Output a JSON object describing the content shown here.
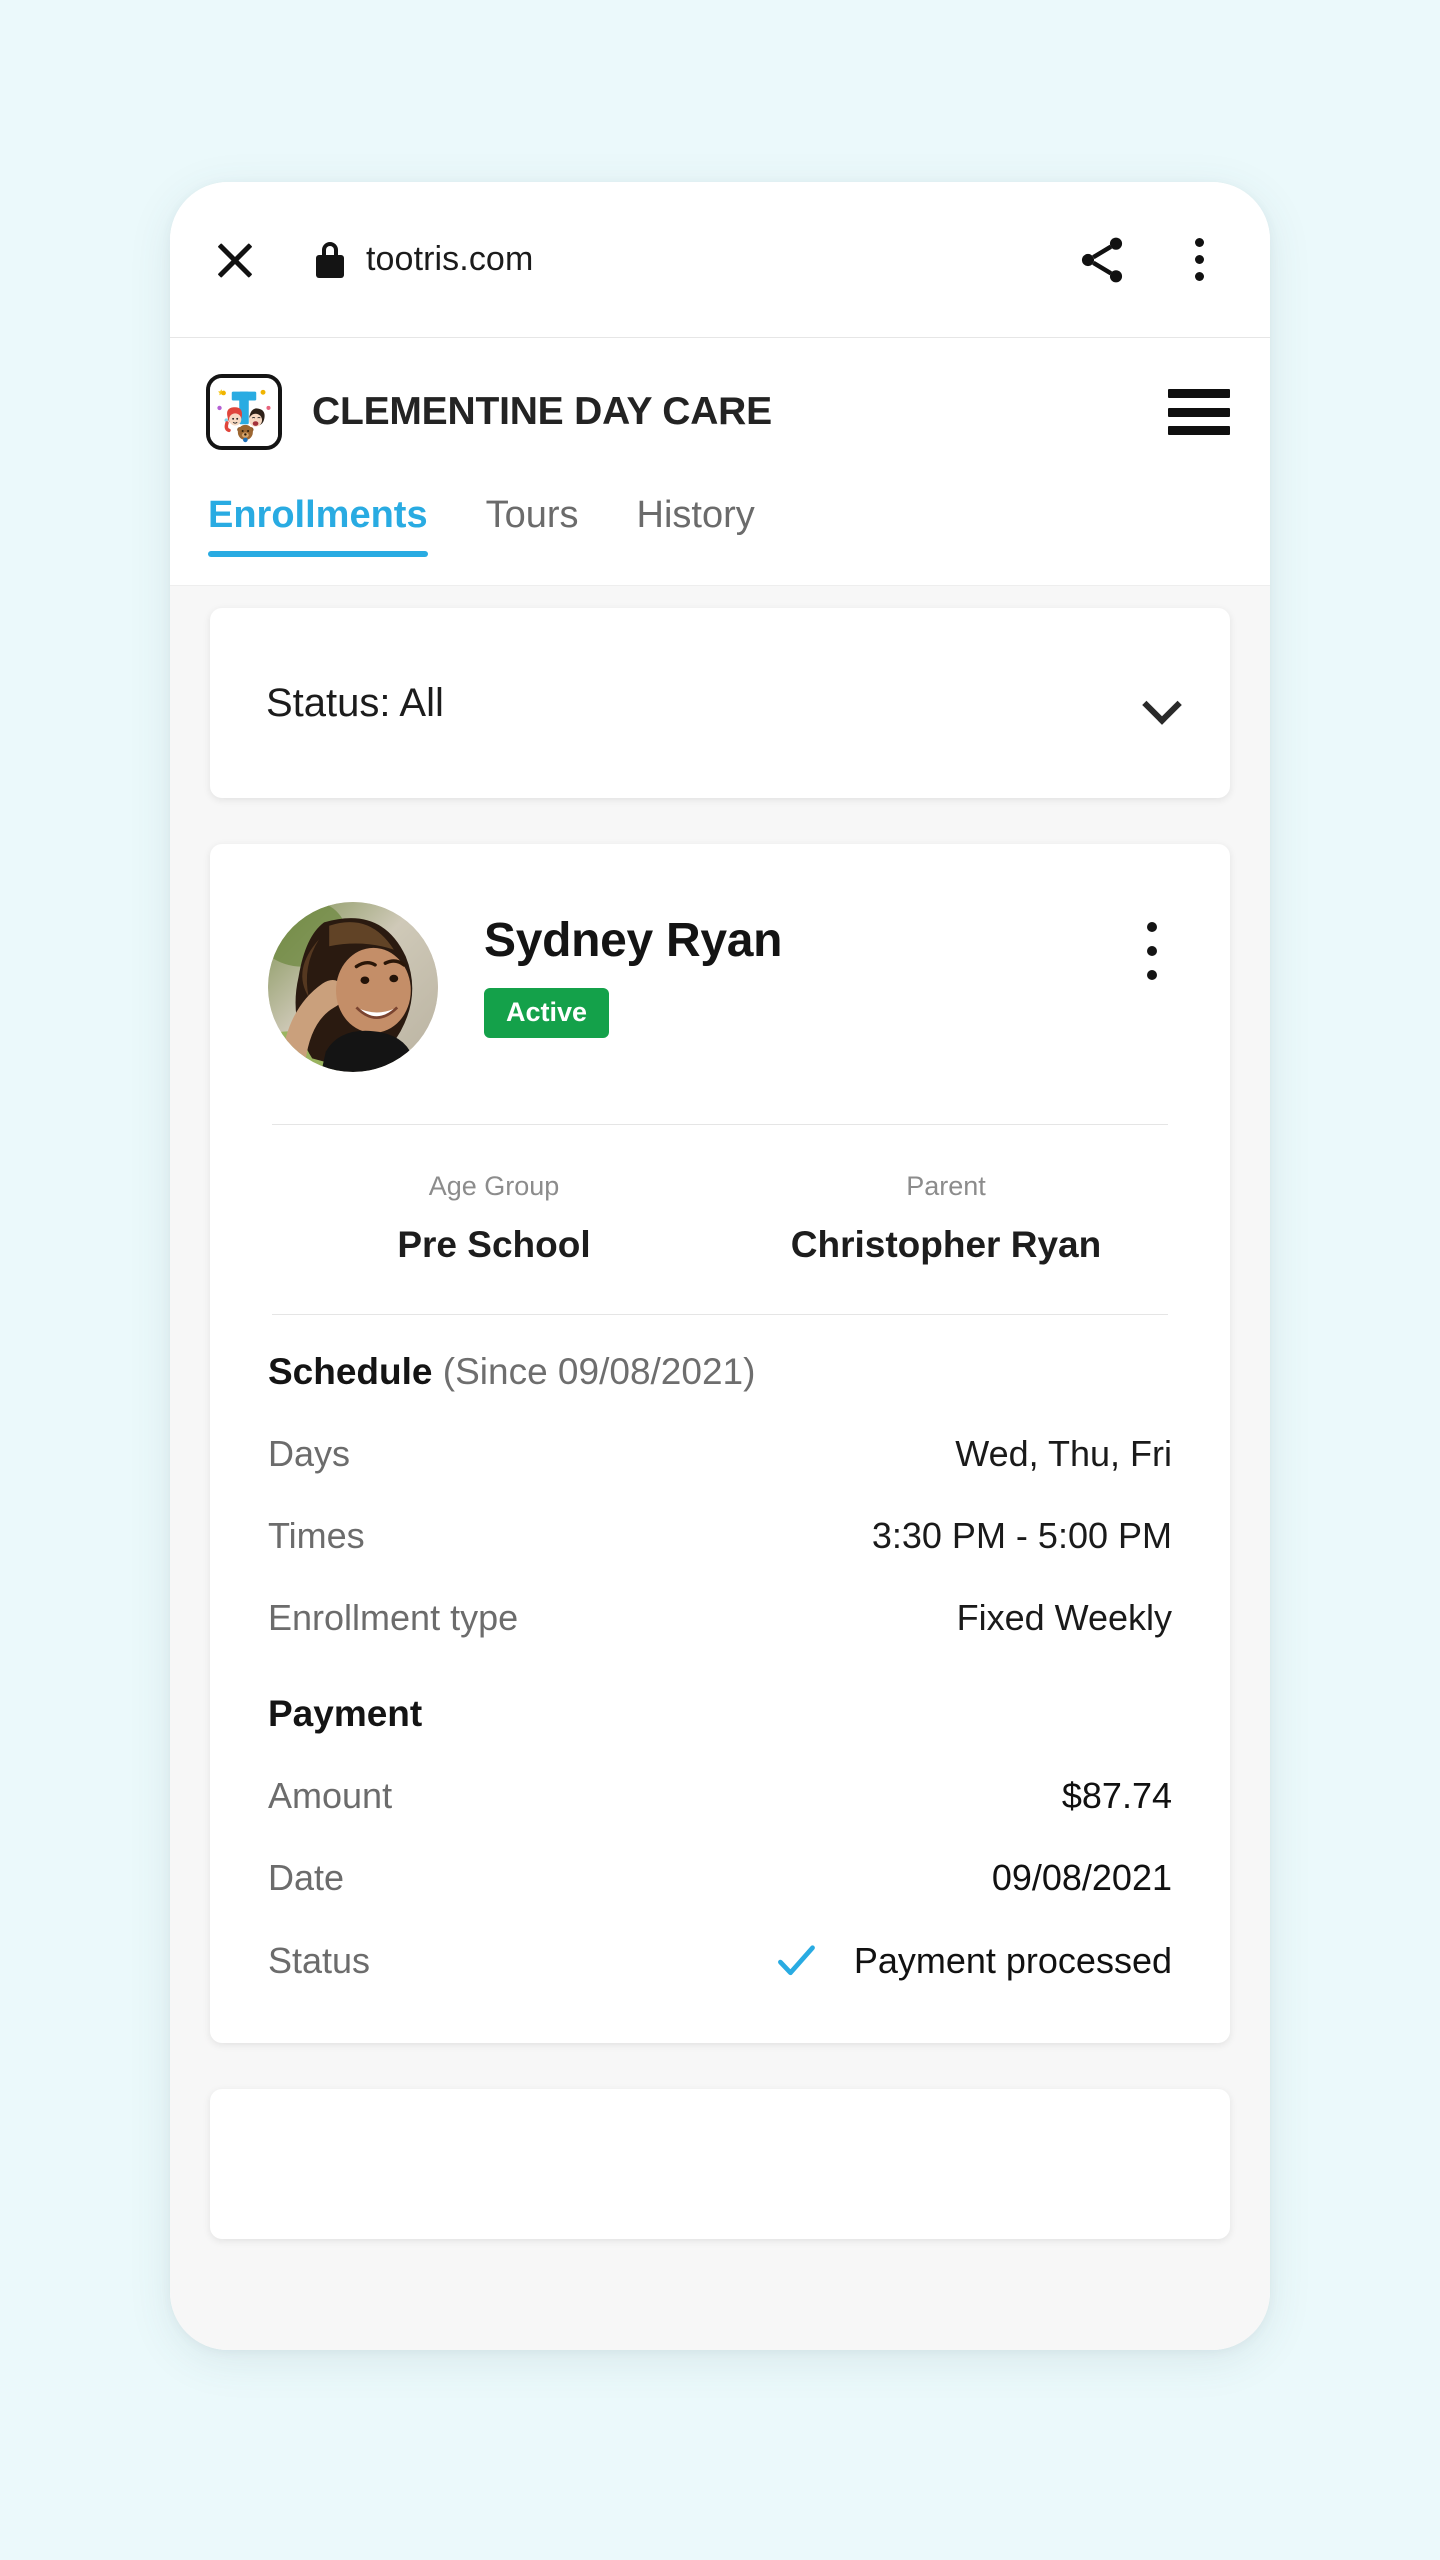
{
  "browser": {
    "close_icon": "close-icon",
    "lock_icon": "lock-icon",
    "url": "tootris.com",
    "share_icon": "share-icon",
    "menu_icon": "three-dot-menu-icon"
  },
  "app_header": {
    "logo_icon": "tootris-logo-icon",
    "title": "CLEMENTINE DAY CARE",
    "hamburger_icon": "hamburger-menu-icon"
  },
  "tabs": [
    {
      "label": "Enrollments",
      "active": true
    },
    {
      "label": "Tours",
      "active": false
    },
    {
      "label": "History",
      "active": false
    }
  ],
  "filter": {
    "label": "Status: All",
    "chevron_icon": "chevron-down-icon"
  },
  "enrollment": {
    "child_name": "Sydney Ryan",
    "status_badge": "Active",
    "avatar_icon": "child-photo-avatar",
    "card_menu_icon": "three-dot-menu-icon",
    "details": [
      {
        "label": "Age Group",
        "value": "Pre School"
      },
      {
        "label": "Parent",
        "value": "Christopher Ryan"
      }
    ],
    "schedule": {
      "title": "Schedule",
      "since": "(Since 09/08/2021)",
      "rows": [
        {
          "label": "Days",
          "value": "Wed, Thu, Fri"
        },
        {
          "label": "Times",
          "value": "3:30 PM - 5:00 PM"
        },
        {
          "label": "Enrollment type",
          "value": "Fixed Weekly"
        }
      ]
    },
    "payment": {
      "title": "Payment",
      "rows": [
        {
          "label": "Amount",
          "value": "$87.74"
        },
        {
          "label": "Date",
          "value": "09/08/2021"
        }
      ],
      "status_label": "Status",
      "status_value": "Payment processed",
      "status_check_icon": "checkmark-icon"
    }
  },
  "colors": {
    "page_background": "#ebf9fb",
    "accent_blue": "#29abe2",
    "badge_green": "#14a14a",
    "body_background": "#f7f7f7"
  }
}
